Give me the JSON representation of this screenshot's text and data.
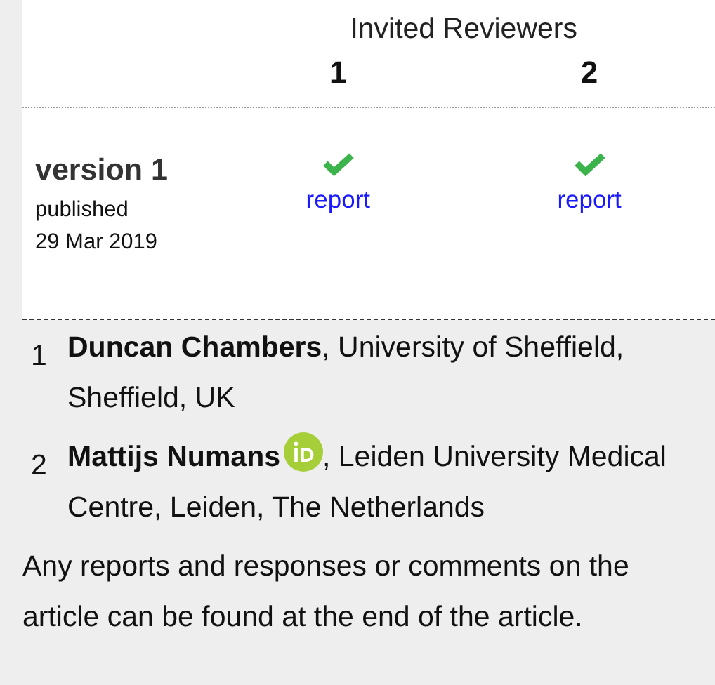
{
  "reviewers_heading": "Invited Reviewers",
  "reviewers": [
    {
      "number": "1",
      "approved": true,
      "report": "report"
    },
    {
      "number": "2",
      "approved": true,
      "report": "report"
    }
  ],
  "version": {
    "title": "version 1",
    "published": "published",
    "date": "29 Mar 2019"
  },
  "affiliations": [
    {
      "number": "1",
      "name": "Duncan Chambers",
      "orcid": false,
      "text": ", University of Sheffield, Sheffield, UK"
    },
    {
      "number": "2",
      "name": "Mattijs Numans",
      "orcid": true,
      "text": ", Leiden University Medical Centre, Leiden, The Netherlands"
    }
  ],
  "note": "Any reports and responses or comments on the article can be found at the end of the article."
}
